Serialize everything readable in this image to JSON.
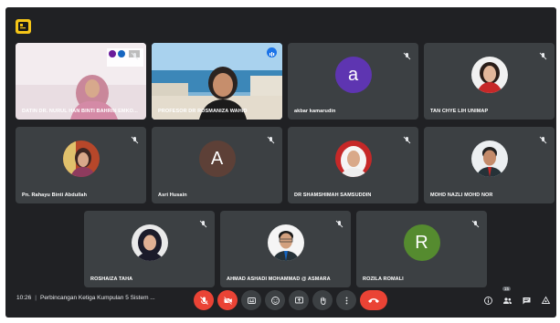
{
  "tiles": [
    {
      "name": "DATIN DR. NURUL HAN BINTI BAHRIN EMKO...",
      "type": "video-woman",
      "mic": "muted"
    },
    {
      "name": "PROFESOR DR ROSMANIZA WAHID",
      "type": "video-speaker",
      "mic": "active"
    },
    {
      "name": "akbar kamarudin",
      "type": "letter",
      "letter": "a",
      "color": "#5e35b1",
      "mic": "muted"
    },
    {
      "name": "TAN CHYE LIH UNIMAP",
      "type": "photo",
      "mic": "muted"
    },
    {
      "name": "Pn. Rahayu Binti Abdullah",
      "type": "photo",
      "mic": "muted"
    },
    {
      "name": "Asri Husain",
      "type": "letter",
      "letter": "A",
      "color": "#5d4037",
      "mic": "muted"
    },
    {
      "name": "DR SHAMSHIMAH SAMSUDDIN",
      "type": "photo",
      "mic": "muted"
    },
    {
      "name": "MOHD NAZLI MOHD NOR",
      "type": "photo",
      "mic": "muted"
    },
    {
      "name": "ROSHAIZA TAHA",
      "type": "photo",
      "mic": "muted"
    },
    {
      "name": "AHMAD ASHADI MOHAMMAD @ ASMARA",
      "type": "photo",
      "mic": "muted"
    },
    {
      "name": "ROZILA ROMALI",
      "type": "letter",
      "letter": "R",
      "color": "#558b2f",
      "mic": "muted"
    }
  ],
  "bottom_bar": {
    "time": "10:26",
    "separator": "|",
    "meeting_title": "Perbincangan Ketiga Kumpulan 5 Sistem ...",
    "participant_count": "15"
  },
  "colors": {
    "accent": "#8ab4f8",
    "danger": "#ea4335",
    "bar": "#202124",
    "tile": "#3c4043"
  }
}
